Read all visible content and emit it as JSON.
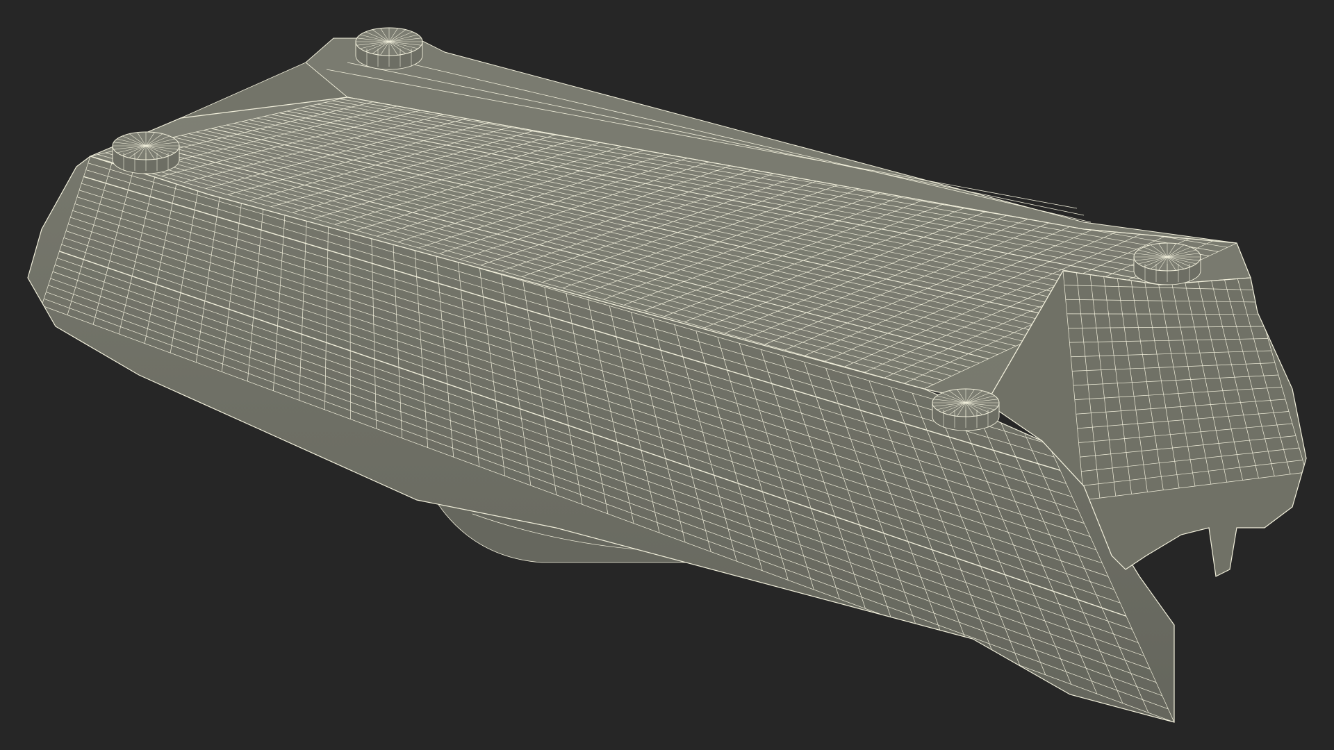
{
  "render": {
    "background_color": "#262626",
    "surface_color": "#7c7d72",
    "surface_dark_color": "#6d6e64",
    "surface_shadow_color": "#5a5b53",
    "wire_color": "#f2f0dc",
    "wire_bright_color": "#ffffff"
  },
  "model": {
    "mounting_pads": [
      {
        "name": "pad-back-left"
      },
      {
        "name": "pad-front-left"
      },
      {
        "name": "pad-back-right"
      },
      {
        "name": "pad-front-right"
      }
    ]
  }
}
